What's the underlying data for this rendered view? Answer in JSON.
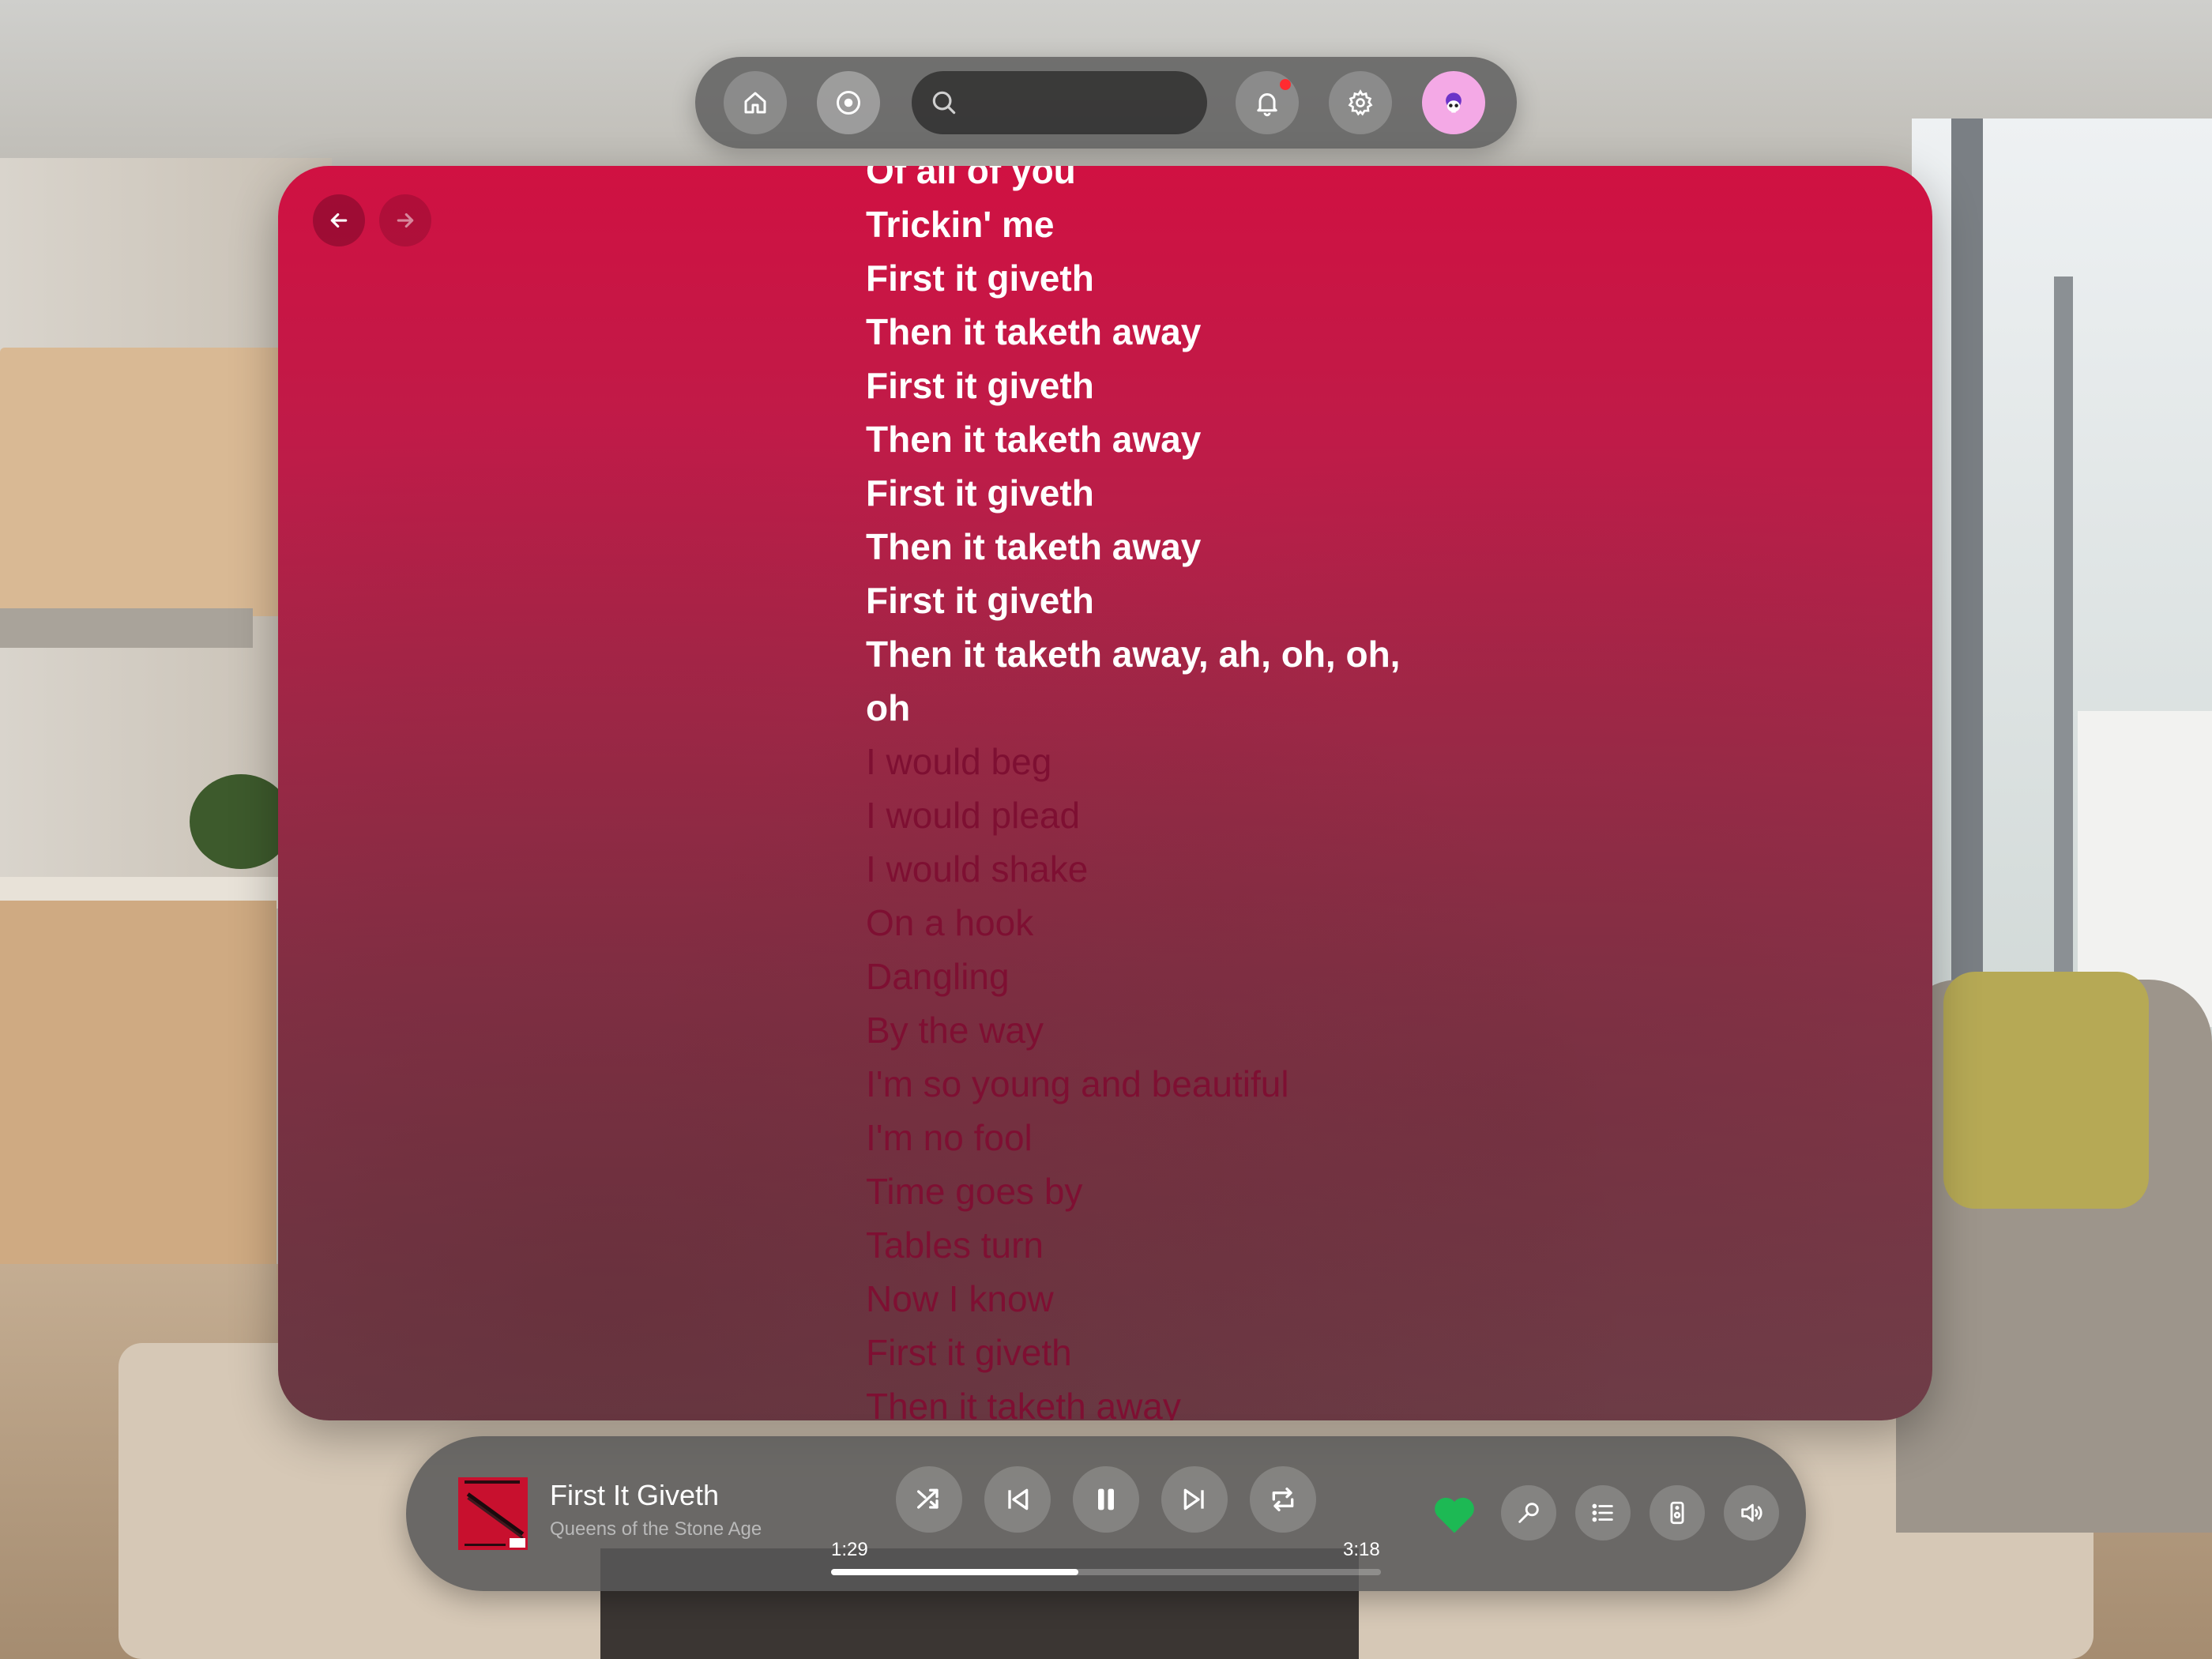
{
  "toolbar": {
    "home": "home-icon",
    "music": "music-disc-icon",
    "search_placeholder": "",
    "notifications": "bell-icon",
    "notification_dot_color": "#ff2b30",
    "settings": "gear-icon",
    "avatar": "avatar"
  },
  "panel": {
    "background_top": "#d01142",
    "background_bottom": "#70404a",
    "past_color": "#ffffff",
    "future_color": "#7e0f32"
  },
  "lyrics": {
    "past_lines": [
      "Of all of you",
      "Trickin' me",
      "First it giveth",
      "Then it taketh away",
      "First it giveth",
      "Then it taketh away",
      "First it giveth",
      "Then it taketh away",
      "First it giveth",
      "Then it taketh away, ah, oh, oh,",
      "oh"
    ],
    "future_lines": [
      "I would beg",
      "I would plead",
      "I would shake",
      "On a hook",
      "Dangling",
      "By the way",
      "I'm so young and beautiful",
      "I'm no fool",
      "Time goes by",
      "Tables turn",
      "Now I know",
      "First it giveth",
      "Then it taketh away"
    ]
  },
  "player": {
    "title": "First It Giveth",
    "artist": "Queens of the Stone Age",
    "current_time": "1:29",
    "total_time": "3:18",
    "progress_fraction": 0.45,
    "liked": true,
    "heart_color": "#1db954",
    "controls": [
      "shuffle-icon",
      "previous-icon",
      "pause-icon",
      "next-icon",
      "repeat-icon"
    ],
    "extras": [
      "heart-icon",
      "microphone-icon",
      "queue-icon",
      "device-icon",
      "volume-icon"
    ]
  }
}
